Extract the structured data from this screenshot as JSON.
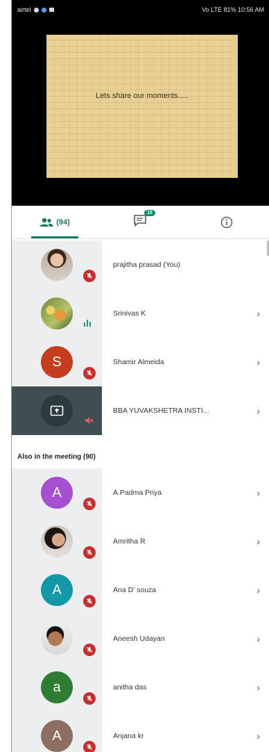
{
  "status_bar": {
    "carrier": "airtel",
    "right": "Vo LTE 81% 10:56 AM"
  },
  "slide": {
    "text": "Lets share our moments....."
  },
  "tabs": {
    "people_count": "(94)",
    "chat_badge": "15"
  },
  "participants": [
    {
      "name": "prajitha prasad (You)",
      "avatar_type": "photo",
      "mic": "muted"
    },
    {
      "name": "Srinivas K",
      "avatar_type": "photo",
      "mic": "speaking"
    },
    {
      "name": "Shamir Almeida",
      "avatar_type": "letter",
      "letter": "S",
      "color": "#c63c1e",
      "mic": "muted"
    },
    {
      "name": "BBA YUVAKSHETRA INSTI...",
      "avatar_type": "presentation",
      "mic": "speaker-off"
    }
  ],
  "section": {
    "label": "Also in the meeting (90)"
  },
  "also": [
    {
      "name": "A.Padma Priya",
      "avatar_type": "letter",
      "letter": "A",
      "color": "#a64fd1"
    },
    {
      "name": "Amritha R",
      "avatar_type": "photo"
    },
    {
      "name": "Ana D' souza",
      "avatar_type": "letter",
      "letter": "A",
      "color": "#1398a8"
    },
    {
      "name": "Aneesh Udayan",
      "avatar_type": "photo"
    },
    {
      "name": "anitha das",
      "avatar_type": "letter",
      "letter": "a",
      "color": "#2e7d32"
    },
    {
      "name": "Anjana kr",
      "avatar_type": "letter",
      "letter": "A",
      "color": "#8d6e63"
    }
  ],
  "icons": {
    "people": "people-icon",
    "chat": "chat-icon",
    "info": "info-icon",
    "chevron": "chevron-right-icon",
    "mic_off": "mic-off-icon"
  },
  "colors": {
    "accent": "#167a5e",
    "mic_off": "#c7302d"
  }
}
